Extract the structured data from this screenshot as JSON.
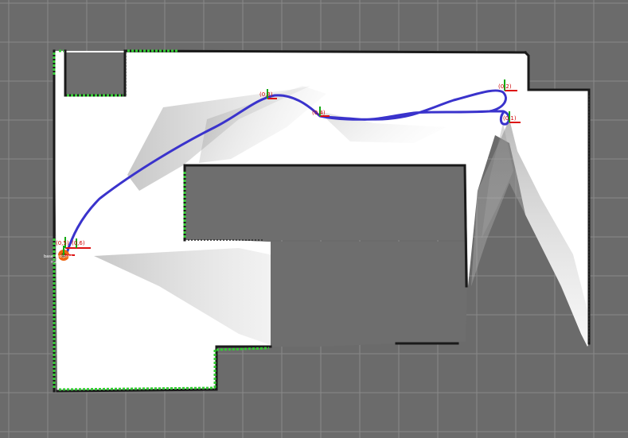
{
  "view": {
    "background": "#6b6b6b",
    "grid_color": "#8a8a8a",
    "map_free_color": "#ffffff",
    "map_unknown_color": "#6e6e6e",
    "wall_color": "#1a1a1a",
    "laser_color": "#33cc33",
    "path_color": "#3a33cc",
    "axis_x_color": "#dd1111",
    "axis_y_color": "#11aa11",
    "robot_color": "#ee6611"
  },
  "waypoints": [
    {
      "id": "wp-3",
      "label": "(0,3)"
    },
    {
      "id": "wp-4",
      "label": "(0,4)"
    },
    {
      "id": "wp-2",
      "label": "(0,2)"
    },
    {
      "id": "wp-1",
      "label": "(0,1)"
    },
    {
      "id": "wp-start-a",
      "label": "(0,5)"
    },
    {
      "id": "wp-start-b",
      "label": "(0,6)"
    }
  ],
  "robot": {
    "name_label": "base_footprint",
    "sub_label": "map"
  }
}
